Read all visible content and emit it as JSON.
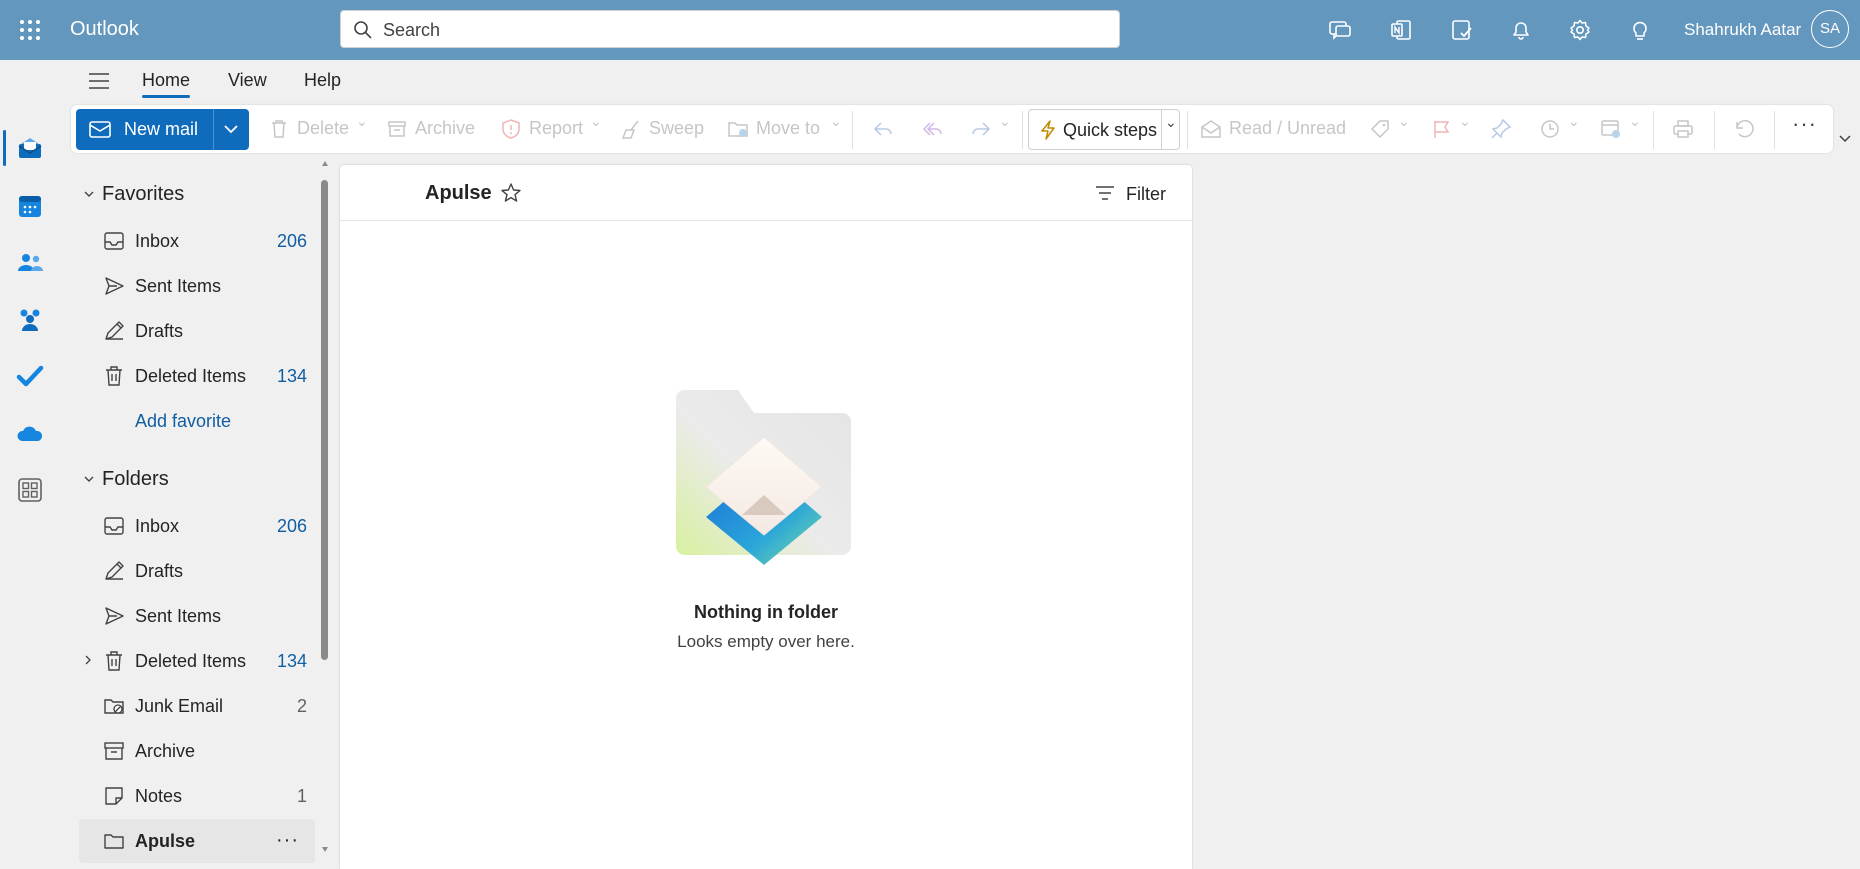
{
  "app": {
    "title": "Outlook"
  },
  "search": {
    "placeholder": "Search"
  },
  "header_icons": [
    "teams-chat-icon",
    "onenote-icon",
    "todo-icon",
    "bell-icon",
    "gear-icon",
    "lightbulb-icon"
  ],
  "user": {
    "name": "Shahrukh Aatar",
    "initials": "SA"
  },
  "rail": [
    "mail-icon",
    "calendar-icon",
    "people-icon",
    "groups-icon",
    "todo-check-icon",
    "onedrive-icon",
    "apps-icon"
  ],
  "tabs": [
    {
      "label": "Home",
      "active": true
    },
    {
      "label": "View",
      "active": false
    },
    {
      "label": "Help",
      "active": false
    }
  ],
  "ribbon": {
    "new_mail": "New mail",
    "delete": "Delete",
    "archive": "Archive",
    "report": "Report",
    "sweep": "Sweep",
    "move_to": "Move to",
    "quick_steps": "Quick steps",
    "read_unread": "Read / Unread"
  },
  "favorites": {
    "label": "Favorites",
    "items": [
      {
        "label": "Inbox",
        "count": "206",
        "icon": "inbox-icon"
      },
      {
        "label": "Sent Items",
        "count": "",
        "icon": "send-icon"
      },
      {
        "label": "Drafts",
        "count": "",
        "icon": "drafts-icon"
      },
      {
        "label": "Deleted Items",
        "count": "134",
        "icon": "trash-icon"
      }
    ],
    "add_favorite": "Add favorite"
  },
  "folders": {
    "label": "Folders",
    "items": [
      {
        "label": "Inbox",
        "count": "206",
        "icon": "inbox-icon"
      },
      {
        "label": "Drafts",
        "count": "",
        "icon": "drafts-icon"
      },
      {
        "label": "Sent Items",
        "count": "",
        "icon": "send-icon"
      },
      {
        "label": "Deleted Items",
        "count": "134",
        "icon": "trash-icon"
      },
      {
        "label": "Junk Email",
        "count": "2",
        "icon": "junk-icon"
      },
      {
        "label": "Archive",
        "count": "",
        "icon": "archive-icon"
      },
      {
        "label": "Notes",
        "count": "1",
        "icon": "notes-icon"
      },
      {
        "label": "Apulse",
        "count": "",
        "icon": "folder-icon",
        "selected": true
      }
    ]
  },
  "message_list": {
    "folder_title": "Apulse",
    "filter_label": "Filter",
    "empty_title": "Nothing in folder",
    "empty_subtitle": "Looks empty over here."
  },
  "colors": {
    "topbar": "#6497bd",
    "accent": "#0f6cbd",
    "count": "#115ea3"
  }
}
